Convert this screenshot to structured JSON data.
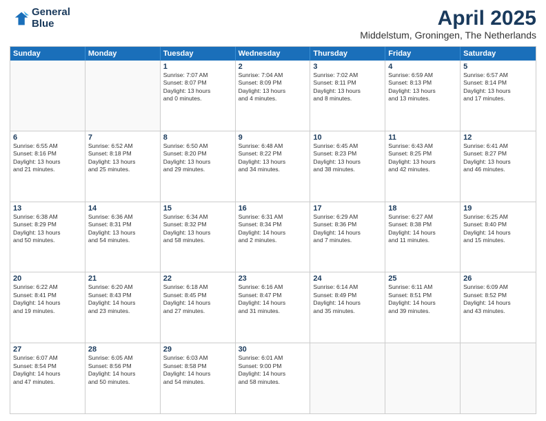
{
  "header": {
    "logo_line1": "General",
    "logo_line2": "Blue",
    "main_title": "April 2025",
    "subtitle": "Middelstum, Groningen, The Netherlands"
  },
  "calendar": {
    "days_of_week": [
      "Sunday",
      "Monday",
      "Tuesday",
      "Wednesday",
      "Thursday",
      "Friday",
      "Saturday"
    ],
    "rows": [
      [
        {
          "day": "",
          "text": ""
        },
        {
          "day": "",
          "text": ""
        },
        {
          "day": "1",
          "text": "Sunrise: 7:07 AM\nSunset: 8:07 PM\nDaylight: 13 hours\nand 0 minutes."
        },
        {
          "day": "2",
          "text": "Sunrise: 7:04 AM\nSunset: 8:09 PM\nDaylight: 13 hours\nand 4 minutes."
        },
        {
          "day": "3",
          "text": "Sunrise: 7:02 AM\nSunset: 8:11 PM\nDaylight: 13 hours\nand 8 minutes."
        },
        {
          "day": "4",
          "text": "Sunrise: 6:59 AM\nSunset: 8:13 PM\nDaylight: 13 hours\nand 13 minutes."
        },
        {
          "day": "5",
          "text": "Sunrise: 6:57 AM\nSunset: 8:14 PM\nDaylight: 13 hours\nand 17 minutes."
        }
      ],
      [
        {
          "day": "6",
          "text": "Sunrise: 6:55 AM\nSunset: 8:16 PM\nDaylight: 13 hours\nand 21 minutes."
        },
        {
          "day": "7",
          "text": "Sunrise: 6:52 AM\nSunset: 8:18 PM\nDaylight: 13 hours\nand 25 minutes."
        },
        {
          "day": "8",
          "text": "Sunrise: 6:50 AM\nSunset: 8:20 PM\nDaylight: 13 hours\nand 29 minutes."
        },
        {
          "day": "9",
          "text": "Sunrise: 6:48 AM\nSunset: 8:22 PM\nDaylight: 13 hours\nand 34 minutes."
        },
        {
          "day": "10",
          "text": "Sunrise: 6:45 AM\nSunset: 8:23 PM\nDaylight: 13 hours\nand 38 minutes."
        },
        {
          "day": "11",
          "text": "Sunrise: 6:43 AM\nSunset: 8:25 PM\nDaylight: 13 hours\nand 42 minutes."
        },
        {
          "day": "12",
          "text": "Sunrise: 6:41 AM\nSunset: 8:27 PM\nDaylight: 13 hours\nand 46 minutes."
        }
      ],
      [
        {
          "day": "13",
          "text": "Sunrise: 6:38 AM\nSunset: 8:29 PM\nDaylight: 13 hours\nand 50 minutes."
        },
        {
          "day": "14",
          "text": "Sunrise: 6:36 AM\nSunset: 8:31 PM\nDaylight: 13 hours\nand 54 minutes."
        },
        {
          "day": "15",
          "text": "Sunrise: 6:34 AM\nSunset: 8:32 PM\nDaylight: 13 hours\nand 58 minutes."
        },
        {
          "day": "16",
          "text": "Sunrise: 6:31 AM\nSunset: 8:34 PM\nDaylight: 14 hours\nand 2 minutes."
        },
        {
          "day": "17",
          "text": "Sunrise: 6:29 AM\nSunset: 8:36 PM\nDaylight: 14 hours\nand 7 minutes."
        },
        {
          "day": "18",
          "text": "Sunrise: 6:27 AM\nSunset: 8:38 PM\nDaylight: 14 hours\nand 11 minutes."
        },
        {
          "day": "19",
          "text": "Sunrise: 6:25 AM\nSunset: 8:40 PM\nDaylight: 14 hours\nand 15 minutes."
        }
      ],
      [
        {
          "day": "20",
          "text": "Sunrise: 6:22 AM\nSunset: 8:41 PM\nDaylight: 14 hours\nand 19 minutes."
        },
        {
          "day": "21",
          "text": "Sunrise: 6:20 AM\nSunset: 8:43 PM\nDaylight: 14 hours\nand 23 minutes."
        },
        {
          "day": "22",
          "text": "Sunrise: 6:18 AM\nSunset: 8:45 PM\nDaylight: 14 hours\nand 27 minutes."
        },
        {
          "day": "23",
          "text": "Sunrise: 6:16 AM\nSunset: 8:47 PM\nDaylight: 14 hours\nand 31 minutes."
        },
        {
          "day": "24",
          "text": "Sunrise: 6:14 AM\nSunset: 8:49 PM\nDaylight: 14 hours\nand 35 minutes."
        },
        {
          "day": "25",
          "text": "Sunrise: 6:11 AM\nSunset: 8:51 PM\nDaylight: 14 hours\nand 39 minutes."
        },
        {
          "day": "26",
          "text": "Sunrise: 6:09 AM\nSunset: 8:52 PM\nDaylight: 14 hours\nand 43 minutes."
        }
      ],
      [
        {
          "day": "27",
          "text": "Sunrise: 6:07 AM\nSunset: 8:54 PM\nDaylight: 14 hours\nand 47 minutes."
        },
        {
          "day": "28",
          "text": "Sunrise: 6:05 AM\nSunset: 8:56 PM\nDaylight: 14 hours\nand 50 minutes."
        },
        {
          "day": "29",
          "text": "Sunrise: 6:03 AM\nSunset: 8:58 PM\nDaylight: 14 hours\nand 54 minutes."
        },
        {
          "day": "30",
          "text": "Sunrise: 6:01 AM\nSunset: 9:00 PM\nDaylight: 14 hours\nand 58 minutes."
        },
        {
          "day": "",
          "text": ""
        },
        {
          "day": "",
          "text": ""
        },
        {
          "day": "",
          "text": ""
        }
      ]
    ]
  }
}
